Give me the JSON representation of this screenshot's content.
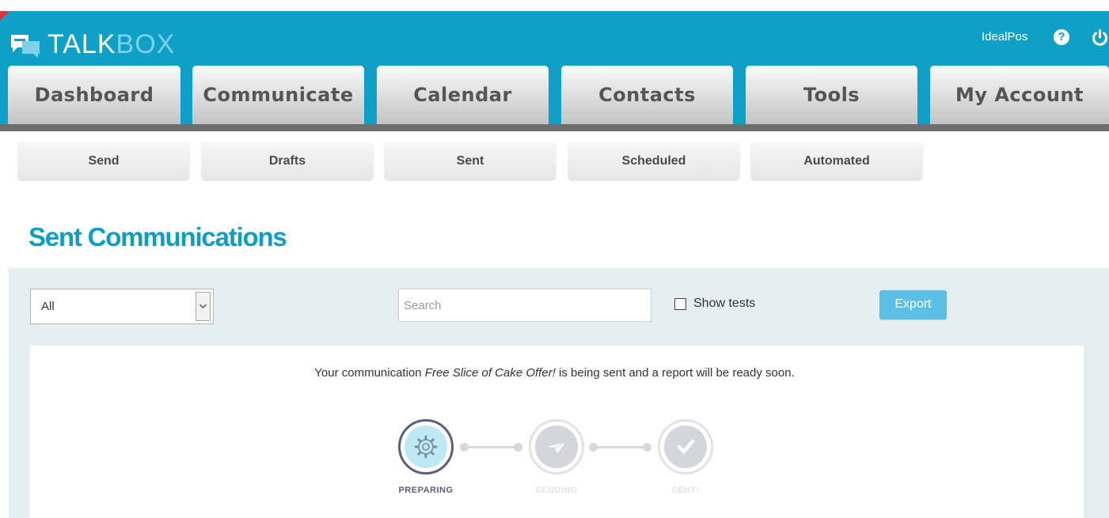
{
  "app": {
    "logo_text_primary": "TALK",
    "logo_text_secondary": "BOX",
    "username": "IdealPos",
    "help_icon": "question-circle-icon",
    "logout_icon": "power-icon"
  },
  "main_nav": {
    "tabs": [
      {
        "label": "Dashboard"
      },
      {
        "label": "Communicate"
      },
      {
        "label": "Calendar"
      },
      {
        "label": "Contacts"
      },
      {
        "label": "Tools"
      },
      {
        "label": "My Account"
      }
    ]
  },
  "sub_nav": {
    "tabs": [
      {
        "label": "Send"
      },
      {
        "label": "Drafts"
      },
      {
        "label": "Sent"
      },
      {
        "label": "Scheduled"
      },
      {
        "label": "Automated"
      }
    ]
  },
  "page": {
    "title": "Sent Communications"
  },
  "filters": {
    "type_select_value": "All",
    "search_placeholder": "Search",
    "search_value": "",
    "show_tests_label": "Show tests",
    "show_tests_checked": false,
    "export_label": "Export"
  },
  "status": {
    "message_prefix": "Your communication ",
    "communication_name": "Free Slice of Cake Offer!",
    "message_suffix": " is being sent and a report will be ready soon.",
    "steps": [
      {
        "label": "PREPARING",
        "icon": "gear-icon",
        "state": "active"
      },
      {
        "label": "SENDING",
        "icon": "paper-plane-icon",
        "state": "pending"
      },
      {
        "label": "SENT!",
        "icon": "checkmark-icon",
        "state": "pending"
      }
    ]
  },
  "colors": {
    "header_bg": "#0fa0c8",
    "title": "#0f9cc6",
    "panel_bg": "#e5eff2",
    "export_bg": "#5bc0e3",
    "step_active": "#5a5f7e",
    "step_pending": "#d8d8e0"
  }
}
